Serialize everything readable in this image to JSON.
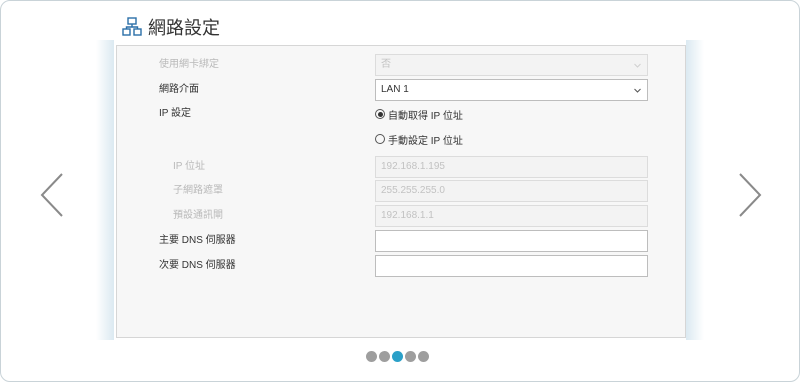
{
  "header": {
    "title": "網路設定",
    "icon": "network-icon"
  },
  "nav": {
    "prev_icon": "chevron-left-icon",
    "next_icon": "chevron-right-icon"
  },
  "form": {
    "nic_binding": {
      "label": "使用網卡綁定",
      "value": "否"
    },
    "interface": {
      "label": "網路介面",
      "value": "LAN 1"
    },
    "ip_setting": {
      "label": "IP 設定",
      "options": [
        "自動取得 IP 位址",
        "手動設定 IP 位址"
      ],
      "selected": "自動取得 IP 位址"
    },
    "ip_address": {
      "label": "IP 位址",
      "value": "192.168.1.195"
    },
    "subnet_mask": {
      "label": "子網路遮罩",
      "value": "255.255.255.0"
    },
    "gateway": {
      "label": "預設通訊閘",
      "value": "192.168.1.1"
    },
    "primary_dns": {
      "label": "主要 DNS 伺服器",
      "value": ""
    },
    "secondary_dns": {
      "label": "次要 DNS 伺服器",
      "value": ""
    }
  },
  "pagination": {
    "total": 5,
    "active_index": 2
  },
  "colors": {
    "active_dot": "#2aa0c8",
    "inactive_dot": "#9e9e9e",
    "disabled_text": "#b9b9b9"
  }
}
